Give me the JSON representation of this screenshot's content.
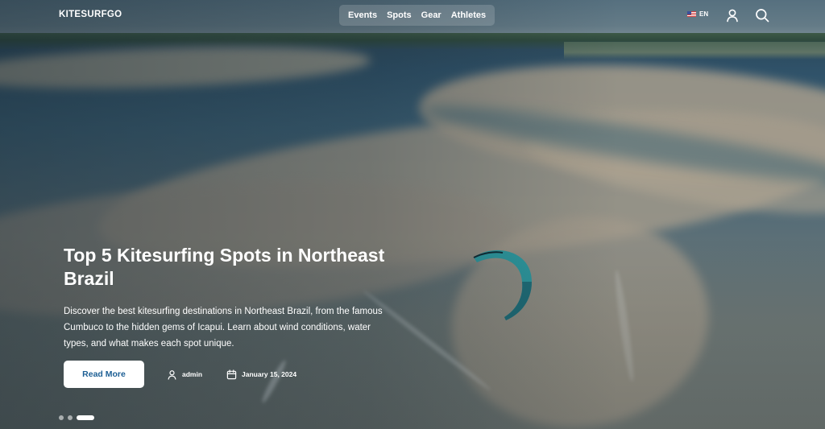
{
  "brand": {
    "logo": "KITESURFGO"
  },
  "nav": {
    "items": [
      "Events",
      "Spots",
      "Gear",
      "Athletes"
    ]
  },
  "header": {
    "language": "EN"
  },
  "icons": {
    "user": "user-icon",
    "search": "search-icon",
    "author": "user-icon",
    "date": "calendar-icon",
    "flag": "us-flag-icon"
  },
  "hero": {
    "title": "Top 5 Kitesurfing Spots in Northeast Brazil",
    "excerpt": "Discover the best kitesurfing destinations in Northeast Brazil, from the famous Cumbuco to the hidden gems of Icapui. Learn about wind conditions, water types, and what makes each spot unique.",
    "cta_label": "Read More",
    "author": "admin",
    "date": "January 15, 2024"
  },
  "carousel": {
    "slide_count": 3,
    "active_index": 2
  },
  "colors": {
    "cta_text": "#1d5f94",
    "kite": "#2f9aa0"
  }
}
